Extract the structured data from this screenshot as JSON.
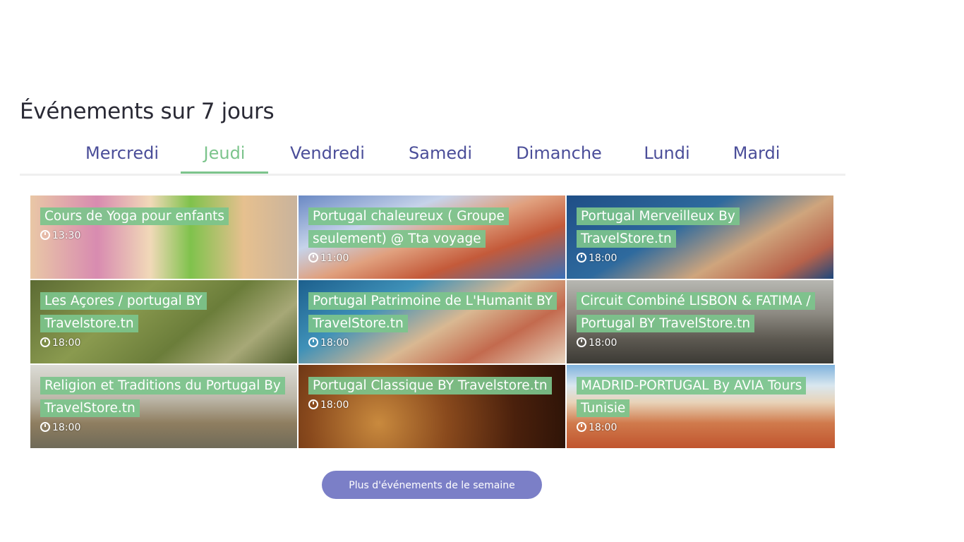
{
  "section_title": "Événements sur 7 jours",
  "tabs": [
    {
      "label": "Mercredi"
    },
    {
      "label": "Jeudi"
    },
    {
      "label": "Vendredi"
    },
    {
      "label": "Samedi"
    },
    {
      "label": "Dimanche"
    },
    {
      "label": "Lundi"
    },
    {
      "label": "Mardi"
    }
  ],
  "active_tab": "Jeudi",
  "events": [
    {
      "title": "Cours de Yoga pour enfants",
      "time": "13:30"
    },
    {
      "title": "Portugal chaleureux ( Groupe seulement) @ Tta voyage",
      "time": "11:00"
    },
    {
      "title": "Portugal Merveilleux By TravelStore.tn",
      "time": "18:00"
    },
    {
      "title": "Les Açores / portugal BY Travelstore.tn",
      "time": "18:00"
    },
    {
      "title": "Portugal Patrimoine de L'Humanit BY TravelStore.tn",
      "time": "18:00"
    },
    {
      "title": "Circuit Combiné LISBON & FATIMA / Portugal BY TravelStore.tn",
      "time": "18:00"
    },
    {
      "title": "Religion et Traditions du Portugal By TravelStore.tn",
      "time": "18:00"
    },
    {
      "title": "Portugal Classique BY Travelstore.tn",
      "time": "18:00"
    },
    {
      "title": "MADRID-PORTUGAL By AVIA Tours Tunisie",
      "time": "18:00"
    }
  ],
  "more_button": "Plus d'événements de le semaine",
  "colors": {
    "accent_green": "#7cc48c",
    "tab_text": "#4b4e99",
    "button_bg": "#7b7fc7"
  }
}
